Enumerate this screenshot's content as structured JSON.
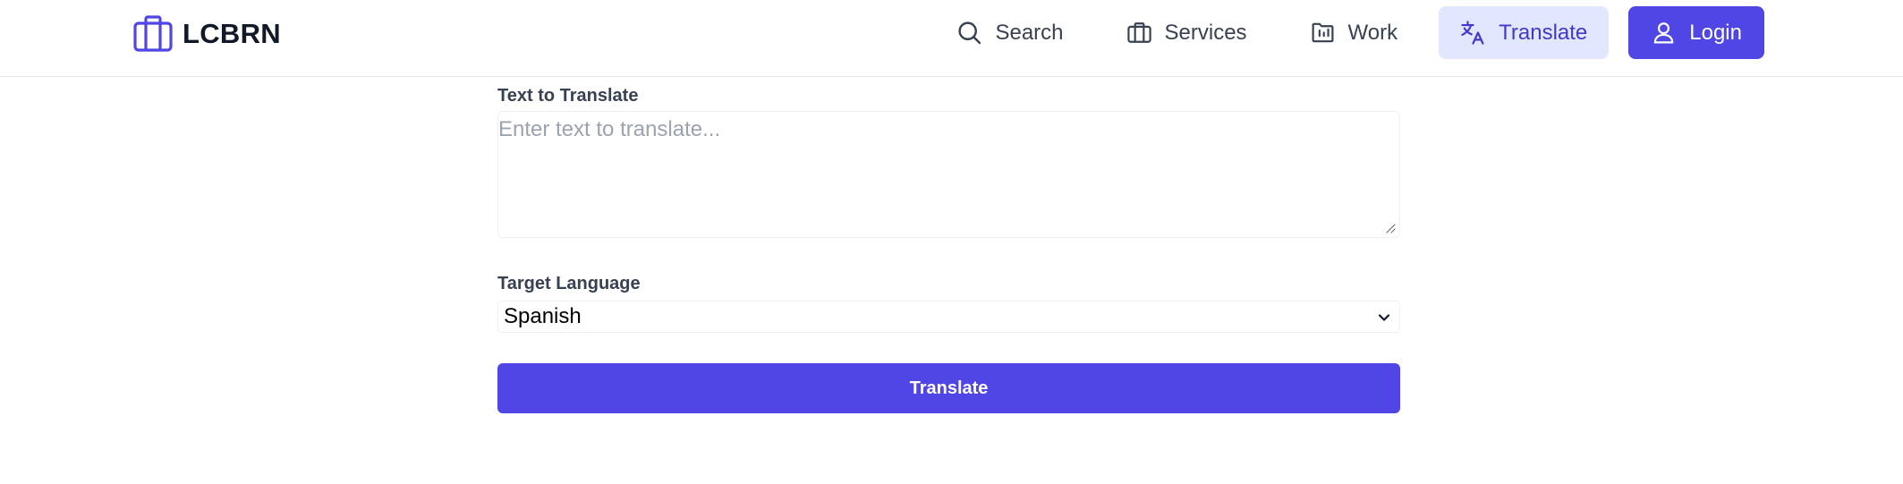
{
  "brand": {
    "name": "LCBRN",
    "icon": "briefcase-icon",
    "color": "#4f46e5"
  },
  "nav": {
    "items": [
      {
        "label": "Search",
        "icon": "search-icon"
      },
      {
        "label": "Services",
        "icon": "briefcase-icon"
      },
      {
        "label": "Work",
        "icon": "folder-icon"
      },
      {
        "label": "Translate",
        "icon": "translate-icon",
        "active": true
      },
      {
        "label": "Login",
        "icon": "user-icon",
        "primary": true
      }
    ]
  },
  "form": {
    "text_label": "Text to Translate",
    "text_placeholder": "Enter text to translate...",
    "text_value": "",
    "language_label": "Target Language",
    "language_selected": "Spanish",
    "submit_label": "Translate"
  },
  "colors": {
    "primary": "#4f46e5",
    "active_bg": "#e0e7ff",
    "active_text": "#4338ca",
    "text_muted": "#374151",
    "placeholder": "#9ca3af"
  }
}
